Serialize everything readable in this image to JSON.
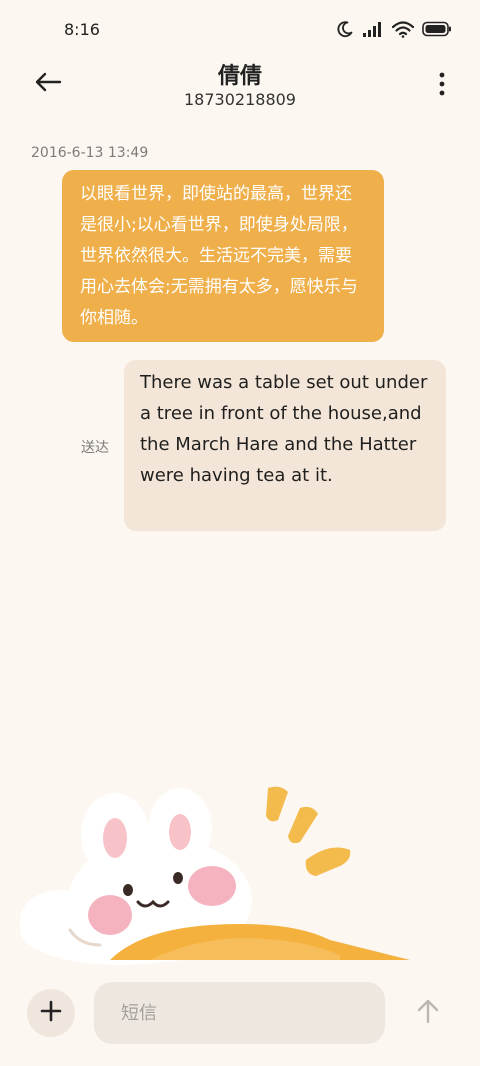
{
  "status_bar": {
    "time": "8:16",
    "icons": [
      "moon-icon",
      "cellular-signal-icon",
      "wifi-icon",
      "battery-icon"
    ]
  },
  "header": {
    "contact_name": "倩倩",
    "contact_number": "18730218809",
    "back_icon": "back-arrow-icon",
    "more_icon": "more-vertical-icon"
  },
  "conversation": {
    "timestamp": "2016-6-13 13:49",
    "messages": [
      {
        "direction": "received",
        "text": "以眼看世界，即使站的最高，世界还是很小;以心看世界，即使身处局限，世界依然很大。生活远不完美，需要用心去体会;无需拥有太多，愿快乐与你相随。"
      },
      {
        "direction": "sent",
        "text": "There was a table set out under a tree in front of the house,and the March Hare and the Hatter were having tea at it.",
        "status": "送达"
      }
    ]
  },
  "input_bar": {
    "add_icon": "plus-icon",
    "placeholder": "短信",
    "value": "",
    "send_icon": "send-arrow-up-icon"
  },
  "colors": {
    "background": "#FDF7F1",
    "received_bubble": "#EFAF4A",
    "sent_bubble": "#F3E5D7",
    "input_background": "#EDE7E0",
    "add_button_background": "#EFE7DE"
  }
}
